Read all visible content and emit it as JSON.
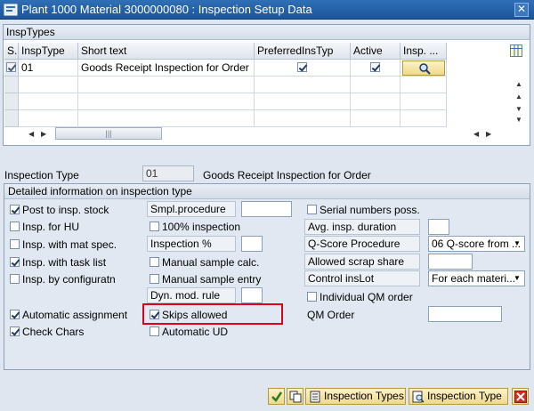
{
  "window": {
    "title": "Plant 1000 Material 3000000080 : Inspection Setup Data",
    "close_glyph": "✕"
  },
  "insp_types_table": {
    "caption": "InspTypes",
    "columns": [
      "S..",
      "InspType",
      "Short text",
      "PreferredInsTyp",
      "Active",
      "Insp. ..."
    ],
    "rows": [
      {
        "selected": true,
        "insp_type": "01",
        "short_text": "Goods Receipt Inspection for Order",
        "preferred": true,
        "active": true
      }
    ],
    "scroll_grip": "|||"
  },
  "inspection_type": {
    "label": "Inspection Type",
    "value": "01",
    "description": "Goods Receipt Inspection for Order"
  },
  "detail_group": {
    "title": "Detailed information on inspection type",
    "left_checks": [
      {
        "label": "Post to insp. stock",
        "checked": true
      },
      {
        "label": "Insp. for HU",
        "checked": false
      },
      {
        "label": "Insp. with mat spec.",
        "checked": false
      },
      {
        "label": "Insp. with task list",
        "checked": true
      },
      {
        "label": "Insp. by configuratn",
        "checked": false
      },
      {
        "label": "Automatic assignment",
        "checked": true
      },
      {
        "label": "Check Chars",
        "checked": true
      }
    ],
    "smpl_procedure": {
      "label": "Smpl.procedure",
      "value": ""
    },
    "inspection_pct": {
      "label": "Inspection %",
      "value": ""
    },
    "dyn_mod_rule": {
      "label": "Dyn. mod. rule",
      "value": ""
    },
    "mid_checks": [
      {
        "label": "100% inspection",
        "checked": false
      },
      {
        "label": "Manual sample calc.",
        "checked": false
      },
      {
        "label": "Manual sample entry",
        "checked": false
      },
      {
        "label": "Skips allowed",
        "checked": true
      },
      {
        "label": "Automatic UD",
        "checked": false
      }
    ],
    "serial_numbers": {
      "label": "Serial numbers poss.",
      "checked": false
    },
    "avg_insp_duration": {
      "label": "Avg. insp. duration",
      "value": ""
    },
    "q_score_procedure": {
      "label": "Q-Score Procedure",
      "value": "06 Q-score from ..."
    },
    "allowed_scrap_share": {
      "label": "Allowed scrap share",
      "value": ""
    },
    "control_ins_lot": {
      "label": "Control insLot",
      "value": "For each materi..."
    },
    "individual_qm_order": {
      "label": "Individual QM order",
      "checked": false
    },
    "qm_order": {
      "label": "QM Order",
      "value": ""
    }
  },
  "footer": {
    "inspection_types_button": "Inspection Types",
    "inspection_type_button": "Inspection Type"
  },
  "colors": {
    "title_bar": "#1d5599",
    "highlight_box": "#e0001b",
    "button_face": "#efd98a"
  }
}
